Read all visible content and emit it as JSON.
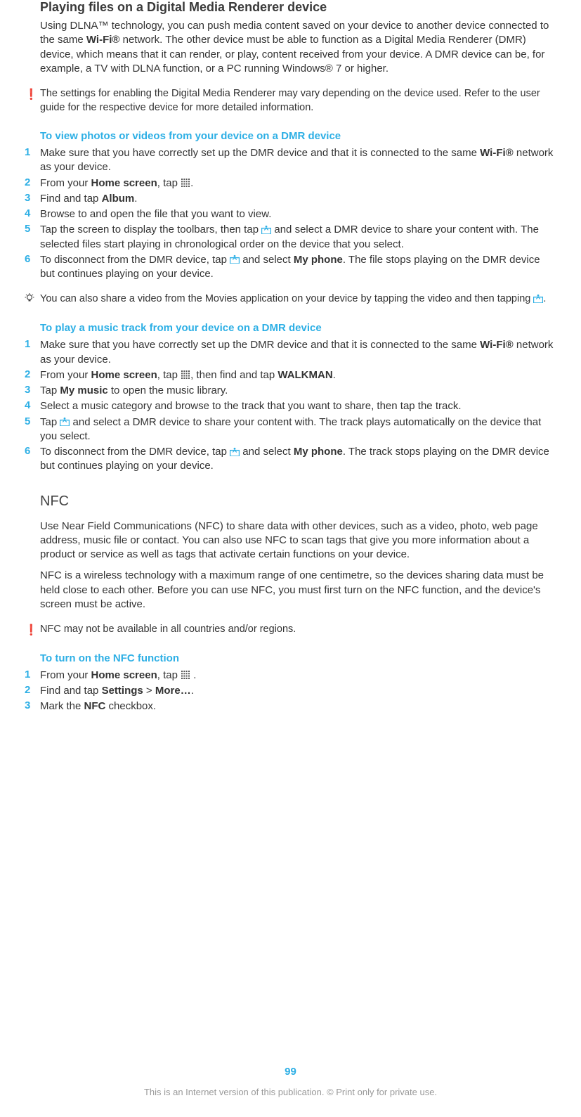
{
  "section1": {
    "title": "Playing files on a Digital Media Renderer device",
    "intro_parts": [
      "Using DLNA™ technology, you can push media content saved on your device to another device connected to the same ",
      "Wi-Fi®",
      " network. The other device must be able to function as a Digital Media Renderer (DMR) device, which means that it can render, or play, content received from your device. A DMR device can be, for example, a TV with DLNA function, or a PC running Windows® 7 or higher."
    ],
    "note": "The settings for enabling the Digital Media Renderer may vary depending on the device used. Refer to the user guide for the respective device for more detailed information."
  },
  "proc1": {
    "heading": "To view photos or videos from your device on a DMR device",
    "steps": [
      {
        "n": "1",
        "parts": [
          "Make sure that you have correctly set up the DMR device and that it is connected to the same ",
          "Wi-Fi®",
          " network as your device."
        ]
      },
      {
        "n": "2",
        "parts": [
          "From your ",
          "Home screen",
          ", tap "
        ],
        "icon_after": "apps",
        "suffix": "."
      },
      {
        "n": "3",
        "parts": [
          "Find and tap ",
          "Album",
          "."
        ]
      },
      {
        "n": "4",
        "parts": [
          "Browse to and open the file that you want to view."
        ]
      },
      {
        "n": "5",
        "parts": [
          "Tap the screen to display the toolbars, then tap "
        ],
        "icon_after": "share",
        "suffix": " and select a DMR device to share your content with. The selected files start playing in chronological order on the device that you select."
      },
      {
        "n": "6",
        "parts": [
          "To disconnect from the DMR device, tap "
        ],
        "icon_after": "share",
        "suffix_parts": [
          " and select ",
          "My phone",
          ". The file stops playing on the DMR device but continues playing on your device."
        ]
      }
    ],
    "tip_parts": [
      "You can also share a video from the Movies application on your device by tapping the video and then tapping "
    ],
    "tip_icon": "share",
    "tip_suffix": "."
  },
  "proc2": {
    "heading": "To play a music track from your device on a DMR device",
    "steps": [
      {
        "n": "1",
        "parts": [
          "Make sure that you have correctly set up the DMR device and that it is connected to the same ",
          "Wi-Fi®",
          " network as your device."
        ]
      },
      {
        "n": "2",
        "parts": [
          "From your ",
          "Home screen",
          ", tap "
        ],
        "icon_after": "apps",
        "suffix_parts": [
          ", then find and tap ",
          "WALKMAN",
          "."
        ]
      },
      {
        "n": "3",
        "parts": [
          "Tap ",
          "My music",
          " to open the music library."
        ]
      },
      {
        "n": "4",
        "parts": [
          "Select a music category and browse to the track that you want to share, then tap the track."
        ]
      },
      {
        "n": "5",
        "parts": [
          "Tap "
        ],
        "icon_after": "share",
        "suffix": " and select a DMR device to share your content with. The track plays automatically on the device that you select."
      },
      {
        "n": "6",
        "parts": [
          "To disconnect from the DMR device, tap "
        ],
        "icon_after": "share",
        "suffix_parts": [
          " and select ",
          "My phone",
          ". The track stops playing on the DMR device but continues playing on your device."
        ]
      }
    ]
  },
  "section2": {
    "heading": "NFC",
    "p1": "Use Near Field Communications (NFC) to share data with other devices, such as a video, photo, web page address, music file or contact. You can also use NFC to scan tags that give you more information about a product or service as well as tags that activate certain functions on your device.",
    "p2": "NFC is a wireless technology with a maximum range of one centimetre, so the devices sharing data must be held close to each other. Before you can use NFC, you must first turn on the NFC function, and the device's screen must be active.",
    "note": "NFC may not be available in all countries and/or regions."
  },
  "proc3": {
    "heading": "To turn on the NFC function",
    "steps": [
      {
        "n": "1",
        "parts": [
          "From your ",
          "Home screen",
          ", tap "
        ],
        "icon_after": "apps",
        "suffix": " ."
      },
      {
        "n": "2",
        "parts": [
          "Find and tap ",
          "Settings",
          " > ",
          "More…",
          "."
        ]
      },
      {
        "n": "3",
        "parts": [
          "Mark the ",
          "NFC",
          " checkbox."
        ]
      }
    ]
  },
  "page_num": "99",
  "footer": "This is an Internet version of this publication. © Print only for private use."
}
